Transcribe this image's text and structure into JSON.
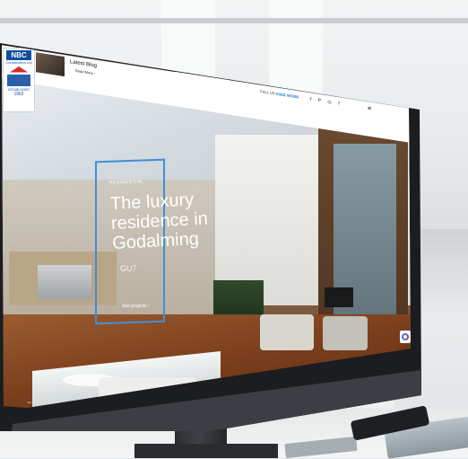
{
  "site": {
    "logo": {
      "brand": "NBC",
      "subtitle": "Construction Ltd",
      "established": "ESTABLISHED",
      "year": "1962"
    },
    "blog": {
      "title": "Latest Blog",
      "link": "Read More ›"
    },
    "call_us": {
      "label": "CALL US",
      "number": "01932 555555"
    },
    "social_icons": [
      "facebook-icon",
      "pinterest-icon",
      "instagram-icon",
      "facebook-f-icon"
    ],
    "menu_icon": "hamburger-icon",
    "hero": {
      "tag": "RESIDENTIAL",
      "title": "The luxury residence in Godalming",
      "code": "GU7",
      "link": "See projects ›"
    },
    "url": "http://www.nbcconstruction.co.uk"
  },
  "colors": {
    "brand_blue": "#0e4ea1",
    "accent_blue": "#3f8fd8",
    "roof_red": "#d62a2a"
  }
}
